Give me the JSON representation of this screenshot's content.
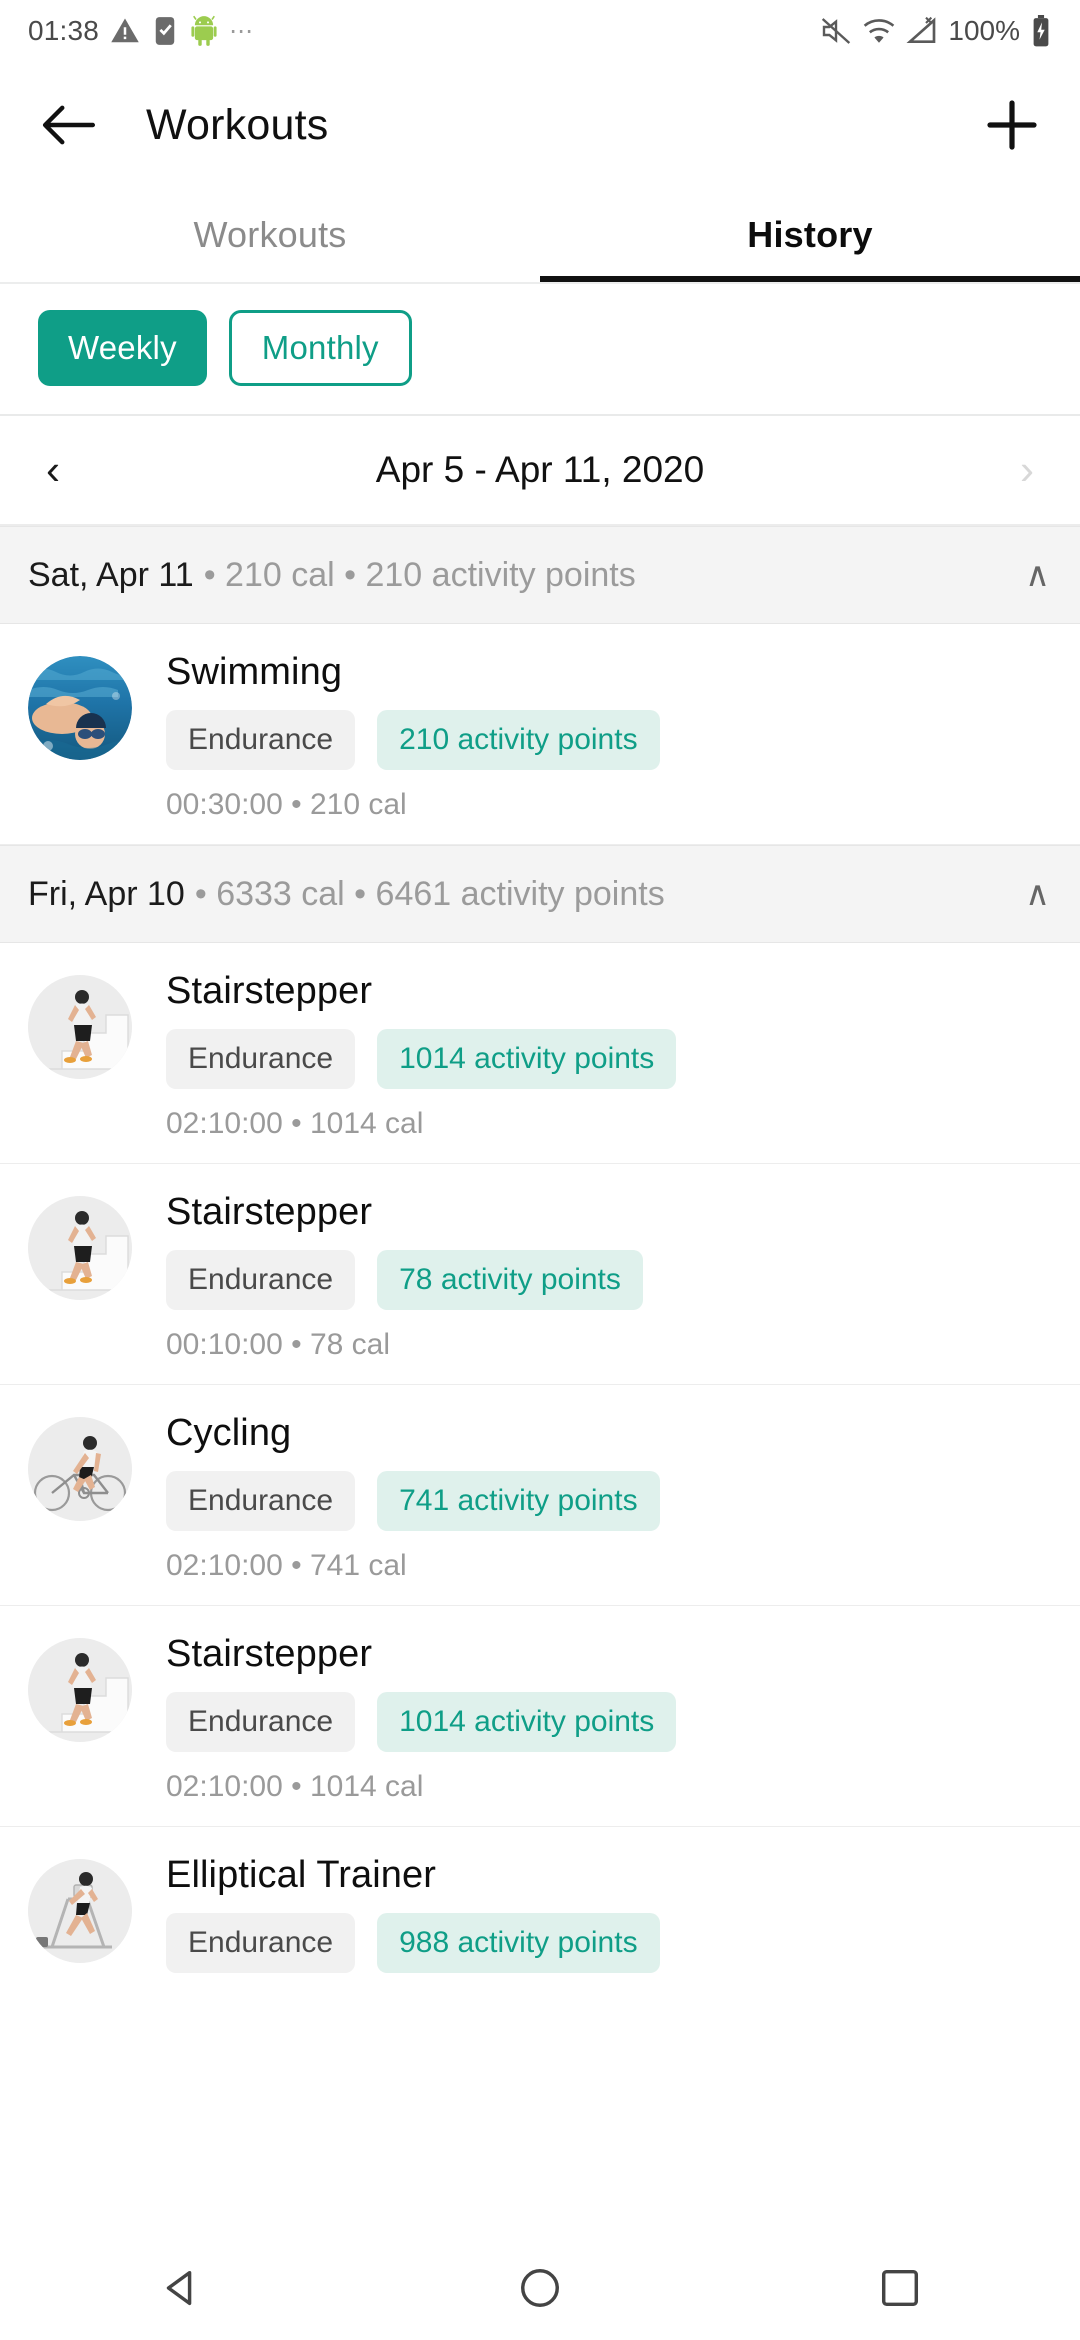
{
  "statusbar": {
    "time": "01:38",
    "battery_percent": "100%",
    "icons": [
      "warning-icon",
      "note-check-icon",
      "android-robot-icon",
      "overflow-dots-icon",
      "mute-icon",
      "wifi-icon",
      "cell-signal-off-icon",
      "battery-charging-icon"
    ]
  },
  "appbar": {
    "back_label": "back-arrow",
    "title": "Workouts",
    "add_label": "add"
  },
  "tabs": [
    {
      "label": "Workouts",
      "active": false
    },
    {
      "label": "History",
      "active": true
    }
  ],
  "filters": [
    {
      "label": "Weekly",
      "selected": true
    },
    {
      "label": "Monthly",
      "selected": false
    }
  ],
  "date_nav": {
    "prev": "‹",
    "range": "Apr 5 - Apr 11, 2020",
    "next": "›"
  },
  "colors": {
    "accent": "#0f9e87",
    "chip_points_bg": "#dff1ec",
    "chip_type_bg": "#f1f1f1",
    "day_header_bg": "#f4f4f4"
  },
  "days": [
    {
      "date": "Sat, Apr 11",
      "meta": "• 210 cal • 210 activity points",
      "collapse_icon": "∧",
      "workouts": [
        {
          "name": "Swimming",
          "type": "Endurance",
          "points": "210 activity points",
          "stats": "00:30:00 • 210 cal",
          "thumb": "swimming-photo"
        }
      ]
    },
    {
      "date": "Fri, Apr 10",
      "meta": "• 6333 cal • 6461 activity points",
      "collapse_icon": "∧",
      "workouts": [
        {
          "name": "Stairstepper",
          "type": "Endurance",
          "points": "1014 activity points",
          "stats": "02:10:00 • 1014 cal",
          "thumb": "stairstepper-photo"
        },
        {
          "name": "Stairstepper",
          "type": "Endurance",
          "points": "78 activity points",
          "stats": "00:10:00 • 78 cal",
          "thumb": "stairstepper-photo"
        },
        {
          "name": "Cycling",
          "type": "Endurance",
          "points": "741 activity points",
          "stats": "02:10:00 • 741 cal",
          "thumb": "cycling-photo"
        },
        {
          "name": "Stairstepper",
          "type": "Endurance",
          "points": "1014 activity points",
          "stats": "02:10:00 • 1014 cal",
          "thumb": "stairstepper-photo"
        },
        {
          "name": "Elliptical Trainer",
          "type": "Endurance",
          "points": "988 activity points",
          "stats": "",
          "thumb": "elliptical-photo"
        }
      ]
    }
  ],
  "navbar": {
    "back": "nav-back",
    "home": "nav-home",
    "recents": "nav-recents"
  }
}
